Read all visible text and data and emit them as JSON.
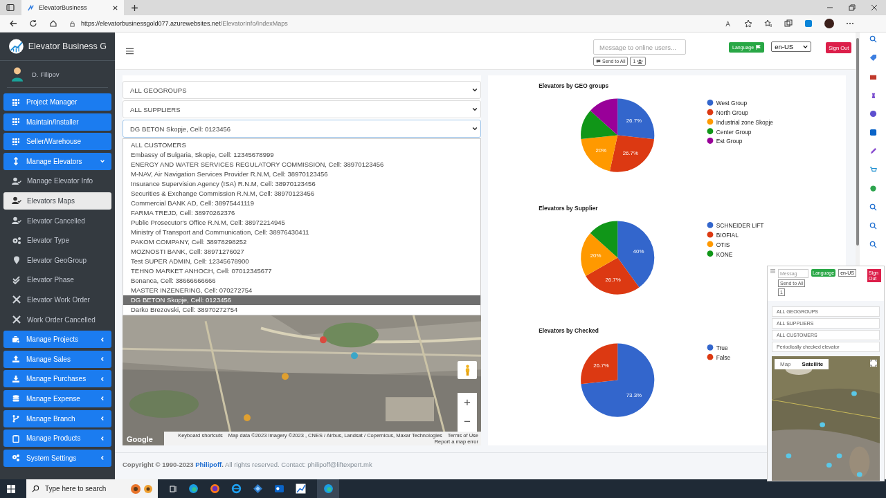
{
  "browser": {
    "tab_title": "ElevatorBusiness",
    "url_host": "https://elevatorbusinessgold077.azurewebsites.net",
    "url_path": "/ElevatorInfo/IndexMaps"
  },
  "sidebar": {
    "brand": "Elevator Business G",
    "user": "D. Filipov",
    "items": [
      {
        "label": "Project Manager",
        "kind": "link"
      },
      {
        "label": "Maintain/Installer",
        "kind": "link"
      },
      {
        "label": "Seller/Warehouse",
        "kind": "link"
      },
      {
        "label": "Manage Elevators",
        "kind": "group",
        "expanded": true,
        "children": [
          {
            "label": "Manage Elevator Info",
            "selected": false
          },
          {
            "label": "Elevators Maps",
            "selected": true
          },
          {
            "label": "Elevator Cancelled",
            "selected": false
          },
          {
            "label": "Elevator Type",
            "selected": false
          },
          {
            "label": "Elevator GeoGroup",
            "selected": false
          },
          {
            "label": "Elevator Phase",
            "selected": false
          },
          {
            "label": "Elevator Work Order",
            "selected": false
          },
          {
            "label": "Work Order Cancelled",
            "selected": false
          }
        ]
      },
      {
        "label": "Manage Projects",
        "kind": "group",
        "expanded": false
      },
      {
        "label": "Manage Sales",
        "kind": "group",
        "expanded": false
      },
      {
        "label": "Manage Purchases",
        "kind": "group",
        "expanded": false
      },
      {
        "label": "Manage Expense",
        "kind": "group",
        "expanded": false
      },
      {
        "label": "Manage Branch",
        "kind": "group",
        "expanded": false
      },
      {
        "label": "Manage Products",
        "kind": "group",
        "expanded": false
      },
      {
        "label": "System Settings",
        "kind": "group",
        "expanded": false
      }
    ]
  },
  "header": {
    "message_placeholder": "Message to online users...",
    "send_button": "Send to All",
    "online_count": "1",
    "language_button": "Language",
    "language_value": "en-US",
    "sign_out": "Sign Out"
  },
  "filters": [
    {
      "value": "ALL GEOGROUPS",
      "open": false
    },
    {
      "value": "ALL SUPPLIERS",
      "open": false
    },
    {
      "value": "DG BETON Skopje, Cell: 0123456",
      "open": true
    }
  ],
  "customer_options": [
    {
      "label": "ALL CUSTOMERS",
      "selected": false
    },
    {
      "label": "Embassy of Bulgaria, Skopje, Cell: 12345678999",
      "selected": false
    },
    {
      "label": "ENERGY AND WATER SERVICES REGULATORY COMMISSION, Cell: 38970123456",
      "selected": false
    },
    {
      "label": "M-NAV, Air Navigation Services Provider R.N.M, Cell: 38970123456",
      "selected": false
    },
    {
      "label": "Insurance Supervision Agency (ISA) R.N.M, Cell: 38970123456",
      "selected": false
    },
    {
      "label": "Securities & Exchange Commission R.N.M, Cell: 38970123456",
      "selected": false
    },
    {
      "label": "Commercial BANK AD, Cell: 38975441119",
      "selected": false
    },
    {
      "label": "FARMA TREJD, Cell: 38970262376",
      "selected": false
    },
    {
      "label": "Public Prosecutor's Office R.N.M, Cell: 38972214945",
      "selected": false
    },
    {
      "label": "Ministry of Transport and Communication, Cell: 38976430411",
      "selected": false
    },
    {
      "label": "PAKOM COMPANY, Cell: 38978298252",
      "selected": false
    },
    {
      "label": "MOZNOSTI BANK, Cell: 38971276027",
      "selected": false
    },
    {
      "label": "Test SUPER ADMIN, Cell: 12345678900",
      "selected": false
    },
    {
      "label": "TEHNO MARKET ANHOCH, Cell: 07012345677",
      "selected": false
    },
    {
      "label": "Bonanca, Cell: 38666666666",
      "selected": false
    },
    {
      "label": "MASTER INZENERING, Cell: 070272754",
      "selected": false
    },
    {
      "label": "DG BETON Skopje, Cell: 0123456",
      "selected": true
    },
    {
      "label": "Darko Brezovski, Cell: 38970272754",
      "selected": false
    }
  ],
  "map": {
    "kind": "picture",
    "logo": "Google",
    "zoom_in": "+",
    "zoom_out": "−",
    "attribution": [
      "Keyboard shortcuts",
      "Map data ©2023 Imagery ©2023 , CNES / Airbus, Landsat / Copernicus, Maxar Technologies",
      "Terms of Use",
      "Report a map error"
    ]
  },
  "charts": [
    {
      "chart_data": {
        "type": "pie",
        "title": "Elevators by GEO groups",
        "categories": [
          "West Group",
          "North Group",
          "Industrial zone Skopje",
          "Center Group",
          "Est Group"
        ],
        "series": [
          {
            "values": [
              26.7,
              26.7,
              20,
              13.3,
              13.3
            ],
            "colors": [
              "#3366cc",
              "#dc3912",
              "#ff9900",
              "#109618",
              "#990099"
            ]
          }
        ],
        "legend": "right",
        "value_labels": [
          "26.7%",
          "26.7%",
          "20%",
          null,
          null
        ]
      }
    },
    {
      "chart_data": {
        "type": "pie",
        "title": "Elevators by Supplier",
        "categories": [
          "SCHNEIDER LIFT",
          "BIOFIAL",
          "OTIS",
          "KONE"
        ],
        "series": [
          {
            "values": [
              40,
              26.7,
              20,
              13.3
            ],
            "colors": [
              "#3366cc",
              "#dc3912",
              "#ff9900",
              "#109618"
            ]
          }
        ],
        "legend": "right",
        "value_labels": [
          "40%",
          "26.7%",
          "20%",
          null
        ]
      }
    },
    {
      "chart_data": {
        "type": "pie",
        "title": "Elevators by Checked",
        "categories": [
          "True",
          "False"
        ],
        "series": [
          {
            "values": [
              73.3,
              26.7
            ],
            "colors": [
              "#3366cc",
              "#dc3912"
            ]
          }
        ],
        "legend": "right",
        "value_labels": [
          "73.3%",
          "26.7%"
        ]
      }
    }
  ],
  "footer": {
    "copyright": "Copyright © 1990-2023 ",
    "brand": "Philipoff",
    "rest": ". All rights reserved. Contact: philipoff@liftexpert.mk"
  },
  "mini_window": {
    "message_placeholder": "Messag",
    "send_button": "Send to All",
    "online_count": "1",
    "language_button": "Language",
    "language_value": "en-US",
    "sign_out": "Sign Out",
    "filters": [
      "ALL GEOGROUPS",
      "ALL SUPPLIERS",
      "ALL CUSTOMERS",
      "Periodically checked elevator"
    ],
    "map_tabs": [
      {
        "label": "Map",
        "selected": false
      },
      {
        "label": "Satellite",
        "selected": true
      }
    ]
  },
  "taskbar": {
    "search_placeholder": "Type here to search"
  }
}
